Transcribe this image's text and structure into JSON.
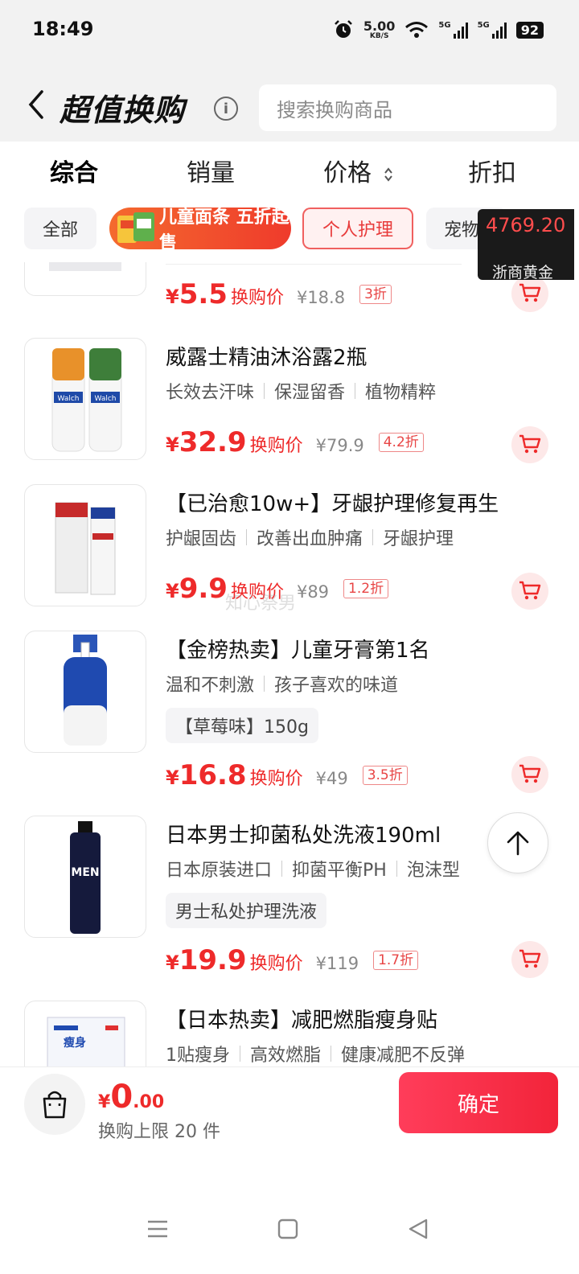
{
  "status_bar": {
    "time": "18:49",
    "net_speed_value": "5.00",
    "net_speed_unit": "KB/S",
    "signal1_label": "5G",
    "signal2_label": "5G",
    "battery": "92"
  },
  "header": {
    "title": "超值换购",
    "search_placeholder": "搜索换购商品"
  },
  "sort_tabs": [
    "综合",
    "销量",
    "价格",
    "折扣"
  ],
  "active_sort": "综合",
  "categories": {
    "all": "全部",
    "promo": "儿童面条 五折起售",
    "personal_care": "个人护理",
    "pets": "宠物"
  },
  "gold_widget": {
    "price": "4769.20",
    "label": "浙商黄金"
  },
  "products": [
    {
      "name": "",
      "price": "5.5",
      "price_label": "换购价",
      "original": "¥18.8",
      "discount": "3折"
    },
    {
      "name": "威露士精油沐浴露2瓶",
      "tags": [
        "长效去汗味",
        "保湿留香",
        "植物精粹"
      ],
      "price": "32.9",
      "price_label": "换购价",
      "original": "¥79.9",
      "discount": "4.2折"
    },
    {
      "name": "【已治愈10w+】牙龈护理修复再生",
      "tags": [
        "护龈固齿",
        "改善出血肿痛",
        "牙龈护理"
      ],
      "price": "9.9",
      "price_label": "换购价",
      "original": "¥89",
      "discount": "1.2折"
    },
    {
      "name": "【金榜热卖】儿童牙膏第1名",
      "tags": [
        "温和不刺激",
        "孩子喜欢的味道"
      ],
      "spec": "【草莓味】150g",
      "price": "16.8",
      "price_label": "换购价",
      "original": "¥49",
      "discount": "3.5折"
    },
    {
      "name": "日本男士抑菌私处洗液190ml",
      "tags": [
        "日本原装进口",
        "抑菌平衡PH",
        "泡沫型"
      ],
      "spec": "男士私处护理洗液",
      "price": "19.9",
      "price_label": "换购价",
      "original": "¥119",
      "discount": "1.7折"
    },
    {
      "name": "【日本热卖】减肥燃脂瘦身贴",
      "tags": [
        "1贴瘦身",
        "高效燃脂",
        "健康减肥不反弹"
      ]
    }
  ],
  "product_image_text": {
    "brand_walch": "Walch",
    "brand_men": "MEN",
    "slim_patch": "瘦身"
  },
  "watermark": "知心祭男",
  "bottom": {
    "currency": "¥",
    "total_int": "0",
    "total_dec": ".00",
    "limit": "换购上限 20 件",
    "confirm": "确定"
  },
  "currency_symbol": "¥",
  "colors": {
    "price_red": "#ee2a2a",
    "confirm_gradient_start": "#ff3d5a",
    "confirm_gradient_end": "#f2243a",
    "chip_selected": "#e83b3b"
  }
}
